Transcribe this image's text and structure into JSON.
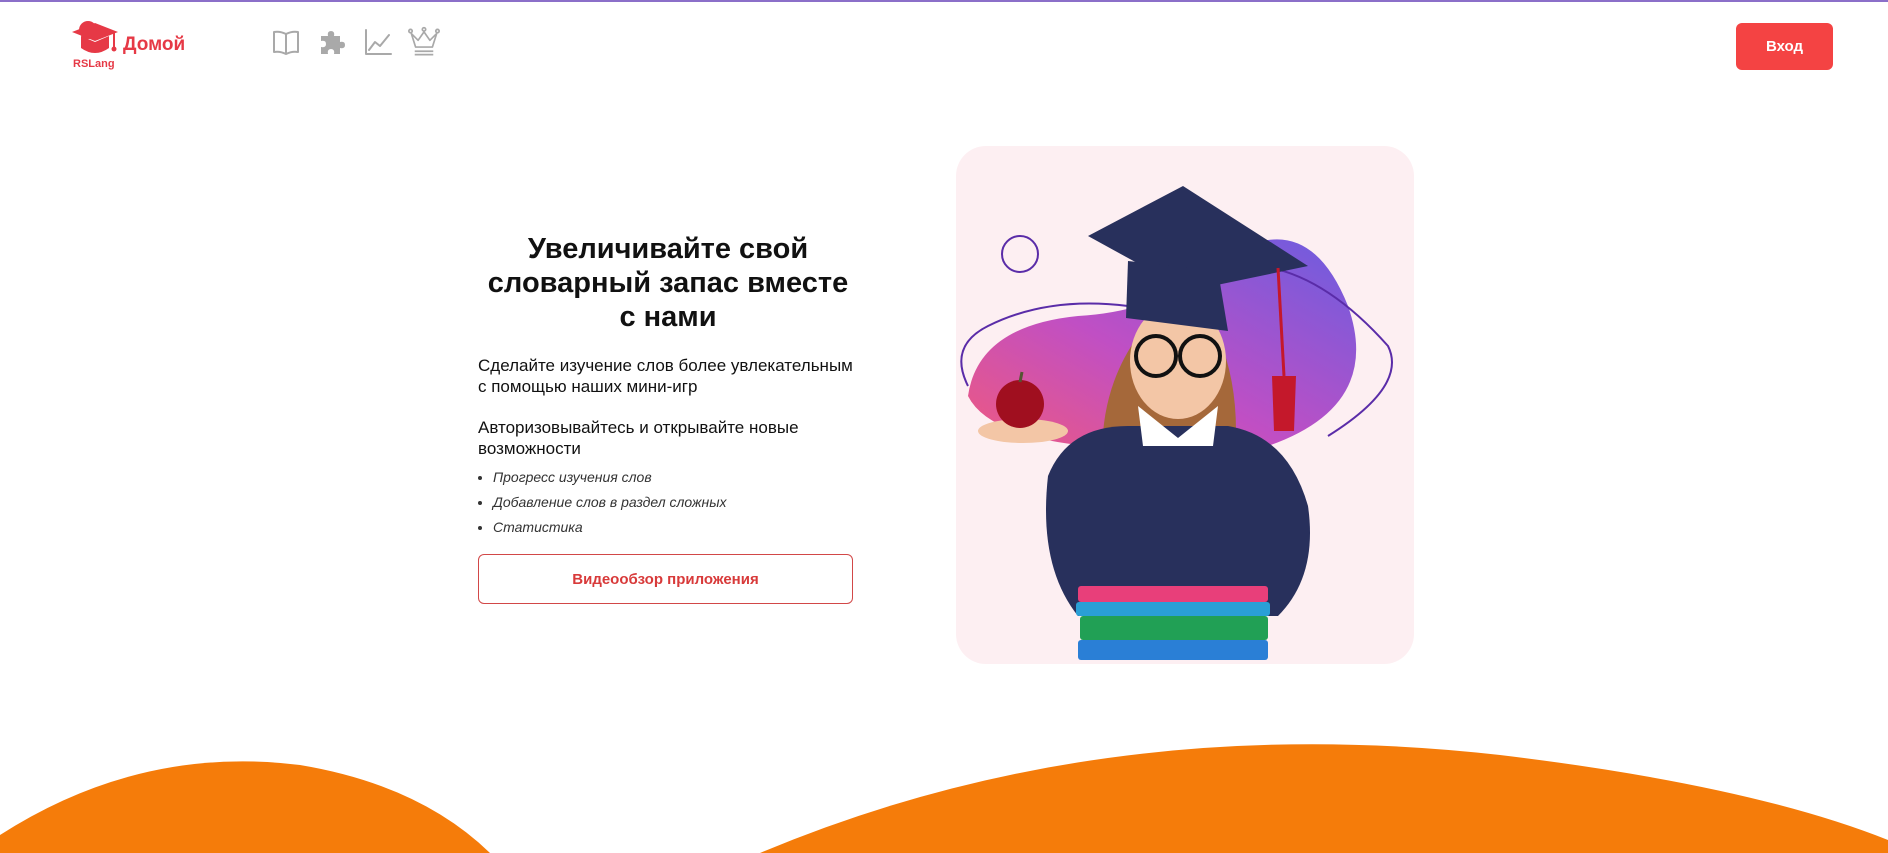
{
  "header": {
    "logo_small": "RSLang",
    "logo_home": "Домой",
    "nav": [
      {
        "icon": "book-icon"
      },
      {
        "icon": "puzzle-icon"
      },
      {
        "icon": "chart-line-icon"
      },
      {
        "icon": "crown-icon"
      }
    ],
    "login_label": "Вход"
  },
  "hero": {
    "title": "Увеличивайте свой словарный запас вместе с нами",
    "subtitle": "Сделайте изучение слов более увлекательным с помощью наших мини-игр",
    "auth_text": "Авторизовывайтесь и открывайте новые возможности",
    "features": [
      "Прогресс изучения слов",
      "Добавление слов в раздел сложных",
      "Статистика"
    ],
    "video_label": "Видеообзор приложения"
  },
  "colors": {
    "accent_red": "#f44343",
    "logo_red": "#e63946",
    "wave_orange": "#f57c0a",
    "top_line": "#8b6fc9",
    "nav_icon_gray": "#a9a9a9",
    "image_bg": "#fdeff2"
  }
}
